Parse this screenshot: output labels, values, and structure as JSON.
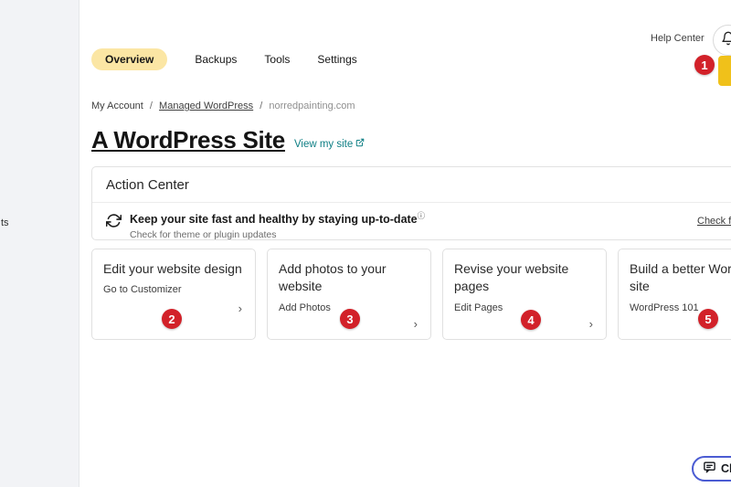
{
  "sidebar": {
    "fragment": "ts"
  },
  "header": {
    "help_center": "Help Center",
    "notification_badge": "1"
  },
  "tabs": [
    {
      "label": "Overview",
      "active": true
    },
    {
      "label": "Backups",
      "active": false
    },
    {
      "label": "Tools",
      "active": false
    },
    {
      "label": "Settings",
      "active": false
    }
  ],
  "breadcrumb": {
    "items": [
      "My Account",
      "Managed WordPress",
      "norredpainting.com"
    ],
    "separator": "/"
  },
  "site": {
    "title": "A WordPress Site",
    "view_link": "View my site"
  },
  "action_center": {
    "heading": "Action Center",
    "task_title": "Keep your site fast and healthy by staying up-to-date",
    "task_subtitle": "Check for theme or plugin updates",
    "link_label": "Check for updates"
  },
  "cards": [
    {
      "title": "Edit your website design",
      "action": "Go to Customizer",
      "badge": "2"
    },
    {
      "title": "Add photos to your website",
      "action": "Add Photos",
      "badge": "3"
    },
    {
      "title": "Revise your website pages",
      "action": "Edit Pages",
      "badge": "4"
    },
    {
      "title": "Build a better WordPress site",
      "action": "WordPress 101",
      "badge": "5"
    }
  ],
  "chat": {
    "label": "Chat"
  },
  "icons": {
    "chevron_right": "›",
    "info": "ⓘ"
  },
  "colors": {
    "accent_yellow": "#f0c11a",
    "active_tab_pill": "#fbe6a4",
    "badge_red": "#d22129",
    "link_teal": "#0d7e84",
    "chat_border": "#4b5cd3",
    "sidebar_bg": "#f2f3f6"
  }
}
